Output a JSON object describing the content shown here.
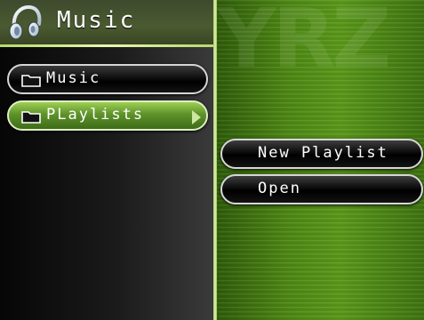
{
  "header": {
    "title": "Music",
    "icon": "headphones-icon"
  },
  "menu": {
    "items": [
      {
        "label": "Music",
        "icon": "folder-icon",
        "selected": false
      },
      {
        "label": "PLaylists",
        "icon": "folder-icon",
        "selected": true
      }
    ]
  },
  "actions": {
    "new_playlist": "New Playlist",
    "open": "Open"
  },
  "colors": {
    "accent_green": "#5d922a",
    "header_bg": "#4a5a30",
    "panel_green": "#4f8a14"
  }
}
